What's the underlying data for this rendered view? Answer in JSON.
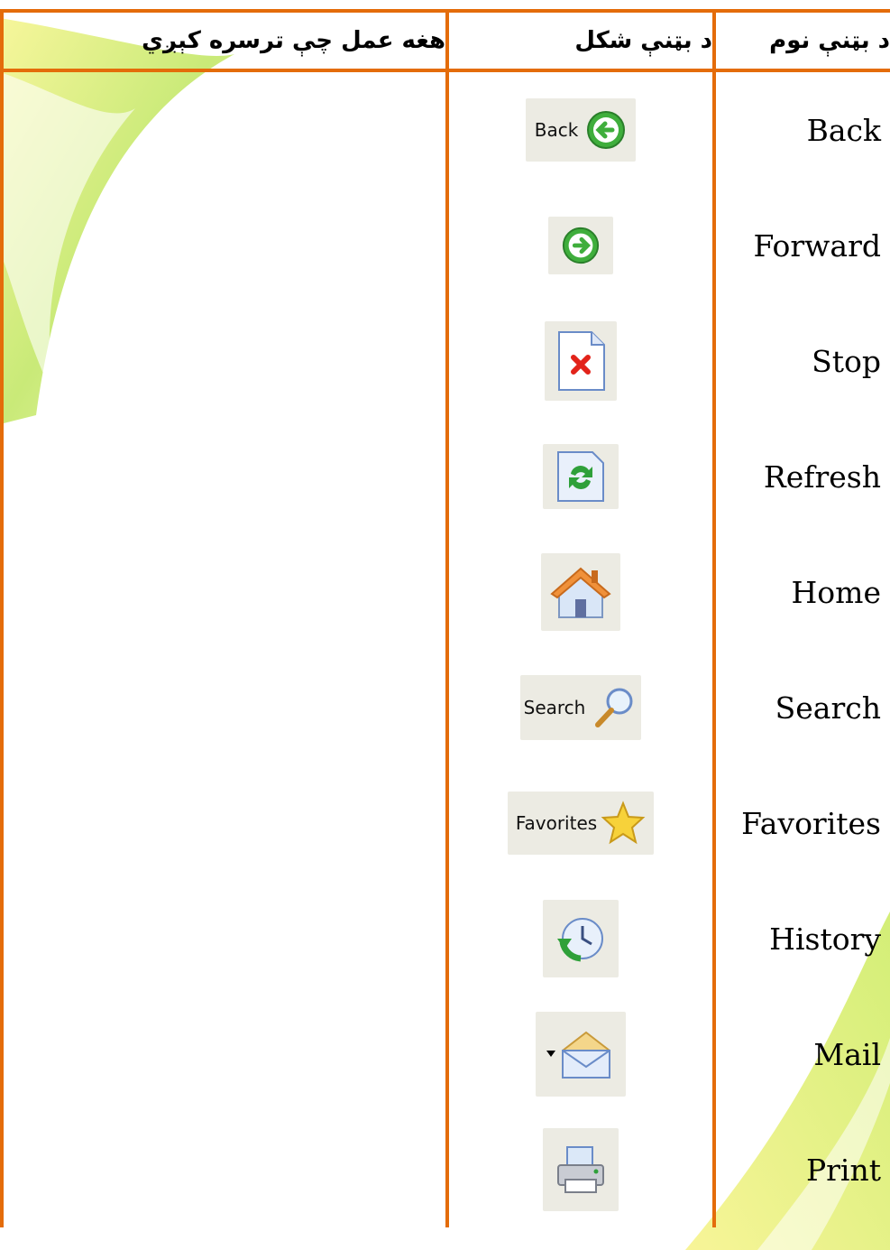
{
  "headers": {
    "name": "د بټنې نوم",
    "icon": "د بټنې شکل",
    "description": "هغه عمل چې ترسره کېږي"
  },
  "rows": [
    {
      "name": "Back",
      "icon": "back-arrow-icon",
      "button_label": "Back"
    },
    {
      "name": "Forward",
      "icon": "forward-arrow-icon"
    },
    {
      "name": "Stop",
      "icon": "stop-page-icon"
    },
    {
      "name": "Refresh",
      "icon": "refresh-page-icon"
    },
    {
      "name": "Home",
      "icon": "home-icon"
    },
    {
      "name": "Search",
      "icon": "search-icon",
      "button_label": "Search"
    },
    {
      "name": "Favorites",
      "icon": "star-icon",
      "button_label": "Favorites"
    },
    {
      "name": "History",
      "icon": "history-clock-icon"
    },
    {
      "name": "Mail",
      "icon": "mail-envelope-icon"
    },
    {
      "name": "Print",
      "icon": "printer-icon"
    }
  ],
  "colors": {
    "border": "#e46c0a",
    "button_bg": "#ecebe3",
    "swirl_green": "#b8e04a",
    "swirl_yellow": "#f3f07a"
  }
}
